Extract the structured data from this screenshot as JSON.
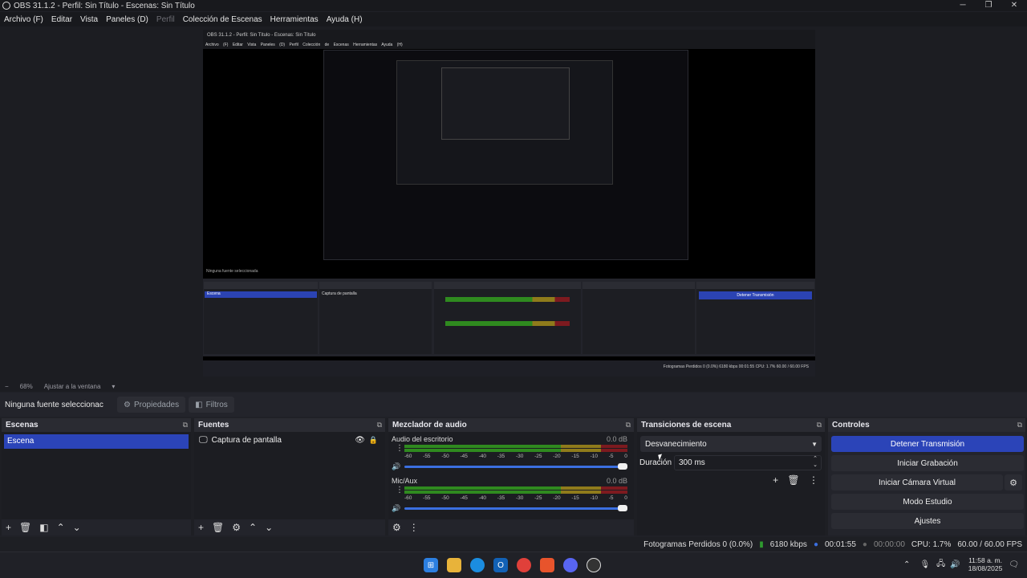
{
  "window": {
    "title": "OBS 31.1.2 - Perfil: Sin Título - Escenas: Sin Título",
    "minimize": "─",
    "maximize": "❐",
    "close": "✕"
  },
  "menu": [
    "Archivo (F)",
    "Editar",
    "Vista",
    "Paneles (D)",
    "Perfil",
    "Colección de Escenas",
    "Herramientas",
    "Ayuda (H)"
  ],
  "preview": {
    "title": "OBS 31.1.2 - Perfil: Sin Título - Escenas: Sin Título",
    "menu": "Archivo (F) Editar Vista Paneles (D) Perfil Colección de Escenas Herramientas Ayuda (H)",
    "source_bar": "Ninguna fuente seleccionada",
    "docks": [
      "Escenas",
      "Fuentes",
      "Mezclador de audio",
      "Transiciones de escena",
      "Controles"
    ],
    "scene": "Escena",
    "source": "Captura de pantalla",
    "stop_btn": "Detener Transmisión",
    "controls": [
      "Iniciar Grabación",
      "Iniciar Cámara Virtual",
      "Modo Estudio",
      "Ajustes"
    ],
    "status": "Fotogramas Perdidos 0 (0.0%)   6180 kbps   00:01:55   CPU: 1.7%   60.00 / 60.00 FPS"
  },
  "zoom": {
    "minus": "−",
    "level": "68%",
    "fit": "Ajustar a la ventana",
    "dropdown": "▾"
  },
  "source_bar": {
    "selection": "Ninguna fuente seleccionac",
    "properties": "Propiedades",
    "filters": "Filtros"
  },
  "scenes": {
    "title": "Escenas",
    "items": [
      "Escena"
    ]
  },
  "sources": {
    "title": "Fuentes",
    "items": [
      "Captura de pantalla"
    ]
  },
  "mixer": {
    "title": "Mezclador de audio",
    "channels": [
      {
        "name": "Audio del escritorio",
        "db": "0.0 dB",
        "volume": 1.0
      },
      {
        "name": "Mic/Aux",
        "db": "0.0 dB",
        "volume": 1.0
      }
    ],
    "ticks": [
      "-60",
      "-55",
      "-50",
      "-45",
      "-40",
      "-35",
      "-30",
      "-25",
      "-20",
      "-15",
      "-10",
      "-5",
      "0"
    ]
  },
  "transitions": {
    "title": "Transiciones de escena",
    "selected": "Desvanecimiento",
    "duration_label": "Duración",
    "duration": "300 ms"
  },
  "controls": {
    "title": "Controles",
    "stop_streaming": "Detener Transmisión",
    "start_recording": "Iniciar Grabación",
    "start_virtual_camera": "Iniciar Cámara Virtual",
    "studio_mode": "Modo Estudio",
    "settings": "Ajustes"
  },
  "status": {
    "dropped": "Fotogramas Perdidos 0 (0.0%)",
    "bitrate": "6180 kbps",
    "stream_time": "00:01:55",
    "rec_time": "00:00:00",
    "cpu": "CPU: 1.7%",
    "fps": "60.00 / 60.00 FPS"
  },
  "taskbar": {
    "time": "11:58 a. m.",
    "date": "18/08/2025"
  },
  "colors": {
    "accent": "#2b44b8",
    "bg": "#1c1d22",
    "meter_green": "#2f8a1f",
    "meter_yellow": "#8f7b1b",
    "meter_red": "#7d1a1f"
  }
}
